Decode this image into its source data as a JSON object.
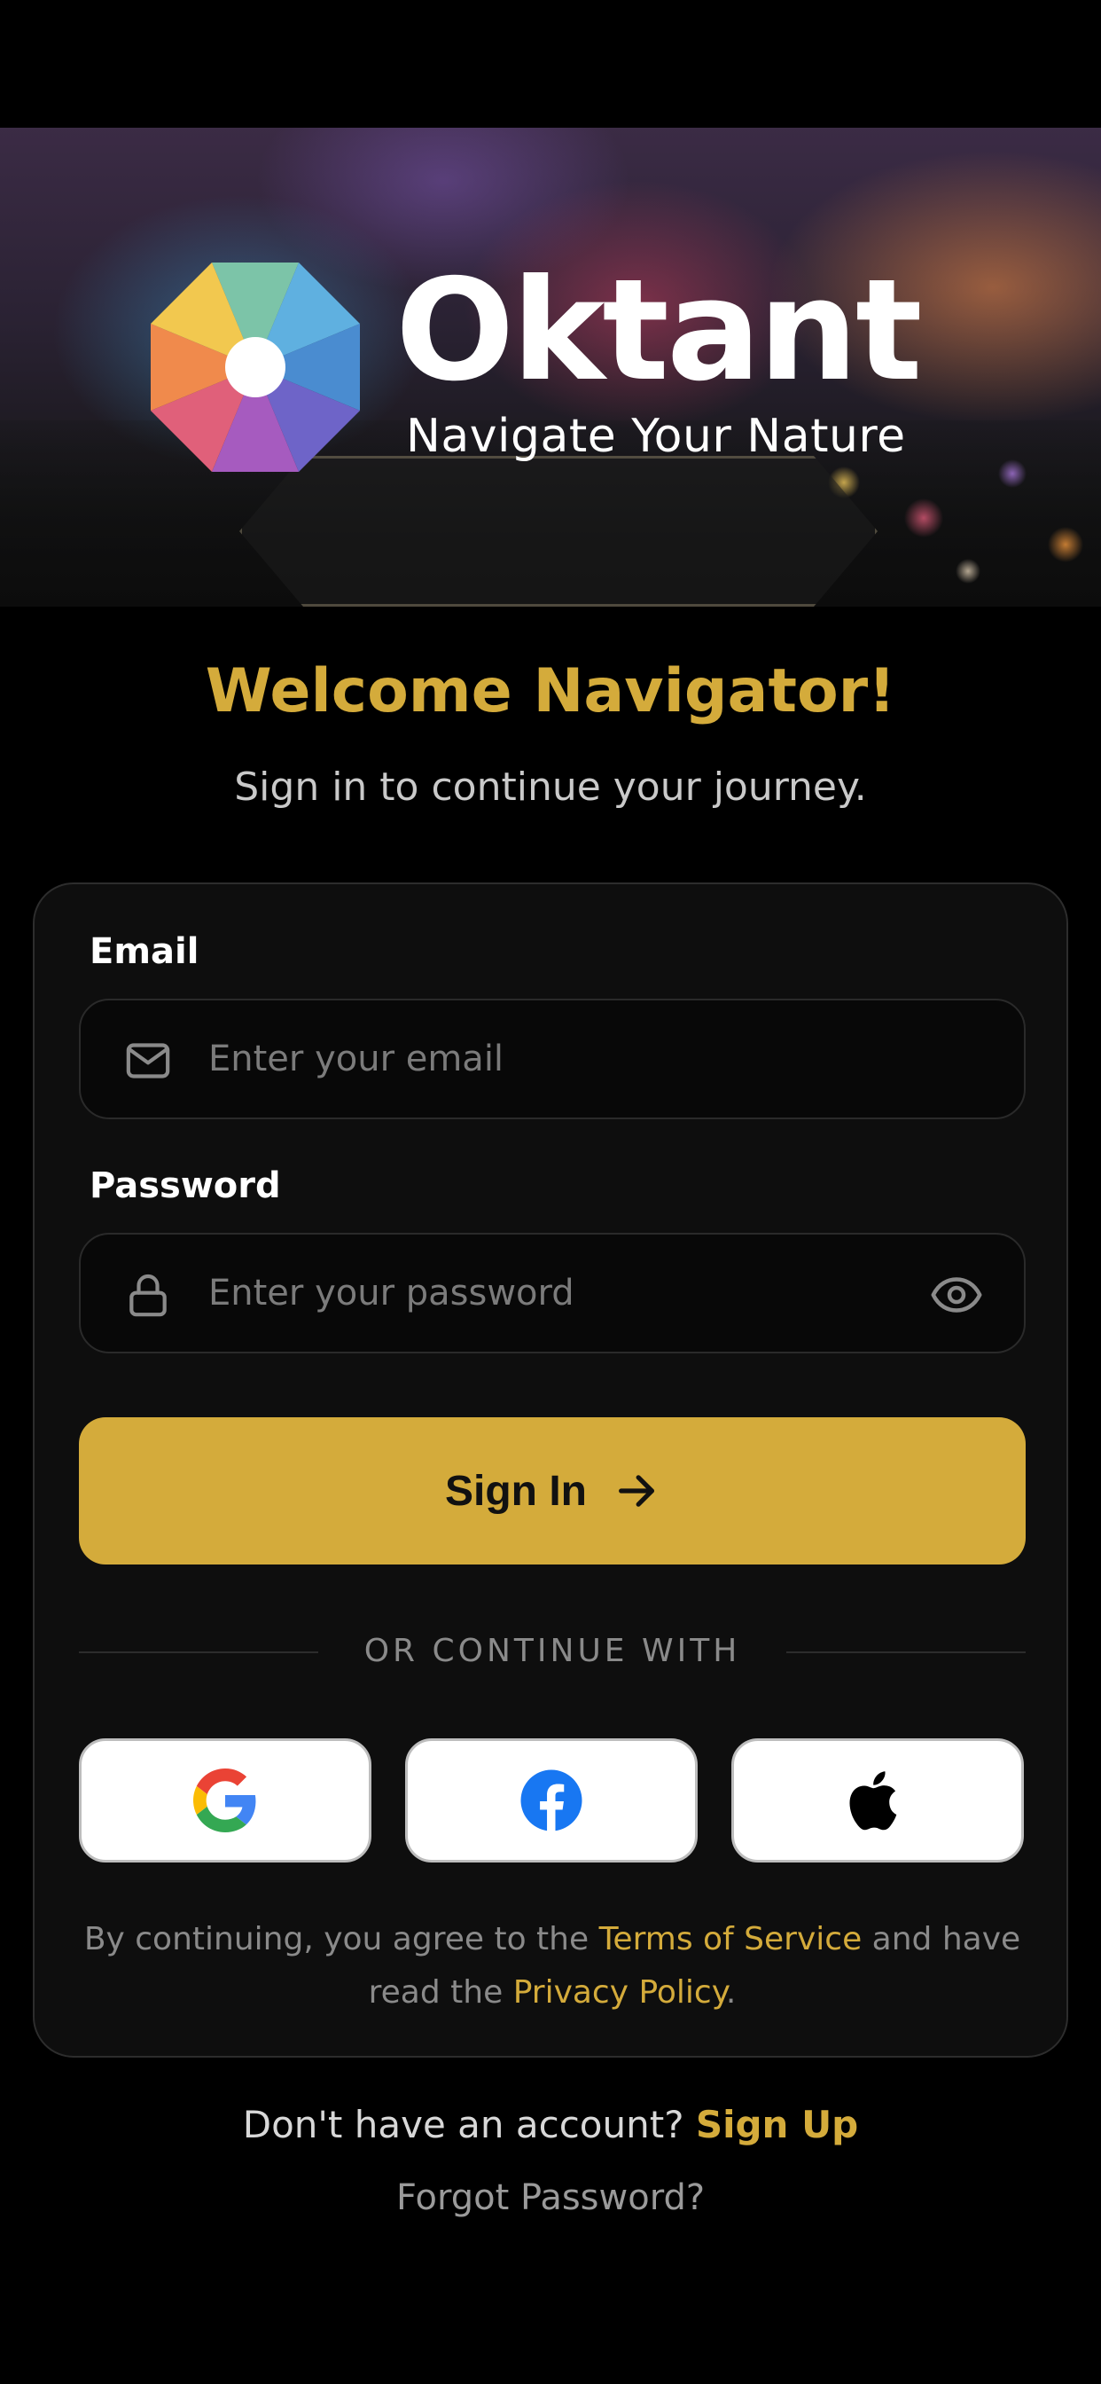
{
  "brand": {
    "name": "Oktant",
    "tagline": "Navigate Your Nature"
  },
  "header": {
    "title": "Welcome Navigator!",
    "subtitle": "Sign in to continue your journey."
  },
  "form": {
    "email": {
      "label": "Email",
      "placeholder": "Enter your email",
      "value": "",
      "icon": "mail-icon"
    },
    "password": {
      "label": "Password",
      "placeholder": "Enter your password",
      "value": "",
      "icon": "lock-icon",
      "toggle_icon": "eye-icon"
    },
    "submit_label": "Sign In",
    "submit_icon": "arrow-right-icon"
  },
  "social": {
    "divider_text": "OR CONTINUE WITH",
    "providers": [
      {
        "name": "Google",
        "icon": "google-icon"
      },
      {
        "name": "Facebook",
        "icon": "facebook-icon"
      },
      {
        "name": "Apple",
        "icon": "apple-icon"
      }
    ]
  },
  "legal": {
    "prefix": "By continuing, you agree to the ",
    "terms": "Terms of Service",
    "middle": " and have read the ",
    "privacy": "Privacy Policy",
    "suffix": "."
  },
  "footer": {
    "prompt": "Don't have an account? ",
    "signup": "Sign Up",
    "forgot": "Forgot Password?"
  },
  "colors": {
    "accent": "#d4ab3b",
    "background": "#000000",
    "card": "#0e0e0e"
  }
}
